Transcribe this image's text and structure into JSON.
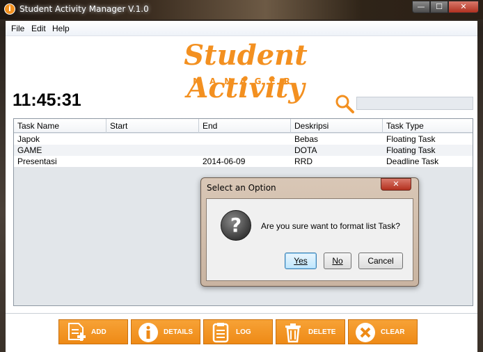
{
  "window": {
    "title": "Student Activity Manager V.1.0",
    "app_icon_glyph": "i",
    "controls": {
      "minimize": "—",
      "maximize": "☐",
      "close": "✕"
    }
  },
  "menu": [
    "File",
    "Edit",
    "Help"
  ],
  "logo": {
    "title": "Student Activity",
    "subtitle": "MANAGER",
    "color": "#f39020"
  },
  "clock": "11:45:31",
  "search": {
    "value": "",
    "placeholder": "",
    "icon": "search-icon"
  },
  "table": {
    "columns": [
      "Task Name",
      "Start",
      "End",
      "Deskripsi",
      "Task Type"
    ],
    "rows": [
      [
        "Japok",
        "",
        "",
        "Bebas",
        "Floating Task"
      ],
      [
        "GAME",
        "",
        "",
        "DOTA",
        "Floating Task"
      ],
      [
        "Presentasi",
        "",
        "2014-06-09",
        "RRD",
        "Deadline Task"
      ]
    ]
  },
  "actions": [
    {
      "label": "ADD",
      "icon": "add-document-icon"
    },
    {
      "label": "DETAILS",
      "icon": "info-icon"
    },
    {
      "label": "LOG",
      "icon": "log-list-icon"
    },
    {
      "label": "DELETE",
      "icon": "trash-icon"
    },
    {
      "label": "CLEAR",
      "icon": "clear-x-icon"
    }
  ],
  "dialog": {
    "title": "Select an Option",
    "message": "Are you sure want to format list Task?",
    "icon": "question-icon",
    "buttons": {
      "yes": "Yes",
      "no": "No",
      "cancel": "Cancel"
    }
  },
  "colors": {
    "accent": "#f39020",
    "button": "#f29520"
  }
}
